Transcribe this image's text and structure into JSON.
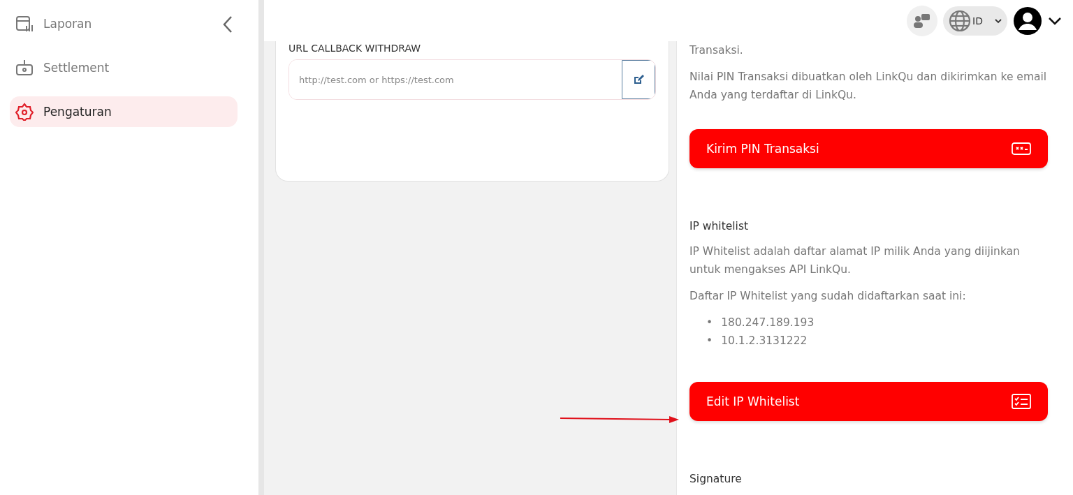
{
  "sidebar": {
    "items": [
      {
        "label": "Laporan",
        "selected": false
      },
      {
        "label": "Settlement",
        "selected": false
      },
      {
        "label": "Pengaturan",
        "selected": true
      }
    ]
  },
  "header": {
    "language": "ID"
  },
  "callback_card": {
    "label": "URL CALLBACK WITHDRAW",
    "placeholder": "http://test.com or https://test.com"
  },
  "settings_panel": {
    "intro": "Transaksi.",
    "pin_text": "Nilai PIN Transaksi dibuatkan oleh LinkQu dan dikirimkan ke email Anda yang terdaftar di LinkQu.",
    "pin_button": "Kirim PIN Transaksi",
    "ip_title": "IP whitelist",
    "ip_text": "IP Whitelist adalah daftar alamat IP milik Anda yang diijinkan untuk mengakses API LinkQu.",
    "ip_list_title": "Daftar IP Whitelist yang sudah didaftarkan saat ini:",
    "ips": [
      {
        "bullet": "•",
        "address": "180.247.189.193"
      },
      {
        "bullet": "•",
        "address": "10.1.2.3131222"
      }
    ],
    "ip_button": "Edit IP Whitelist",
    "signature_title": "Signature"
  }
}
